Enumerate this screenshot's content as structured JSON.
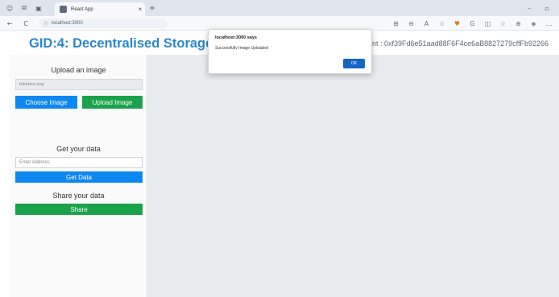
{
  "browser": {
    "tab_title": "React App",
    "tab_close": "×",
    "new_tab": "+",
    "url": "localhost:3000",
    "minimize": "–",
    "restore": "▫",
    "back": "←",
    "reload": "C",
    "info": "ⓘ",
    "extension_icons": [
      "⊞",
      "⊖",
      "A",
      "☆",
      "♥",
      "G",
      "◫",
      "☆",
      "⊕",
      "◈",
      "…"
    ]
  },
  "app": {
    "title": "GID:4: Decentralised Storage",
    "account_text": "ount : 0xf39Fd6e51aad88F6F4ce6aB8827279cffFb92266"
  },
  "sidebar": {
    "upload_heading": "Upload an image",
    "file_name": "tribebee.png",
    "choose_button": "Choose Image",
    "upload_button": "Upload Image",
    "get_heading": "Get your data",
    "address_placeholder": "Enter Address",
    "get_button": "Get Data",
    "share_heading": "Share your data",
    "share_button": "Share"
  },
  "dialog": {
    "title": "localhost:3000 says",
    "message": "Successfully Image Uploaded",
    "ok_label": "OK"
  },
  "colors": {
    "title_blue": "#2a86c9",
    "button_blue": "#0d88f0",
    "button_green": "#1aa24b",
    "dialog_ok": "#1466c4"
  }
}
